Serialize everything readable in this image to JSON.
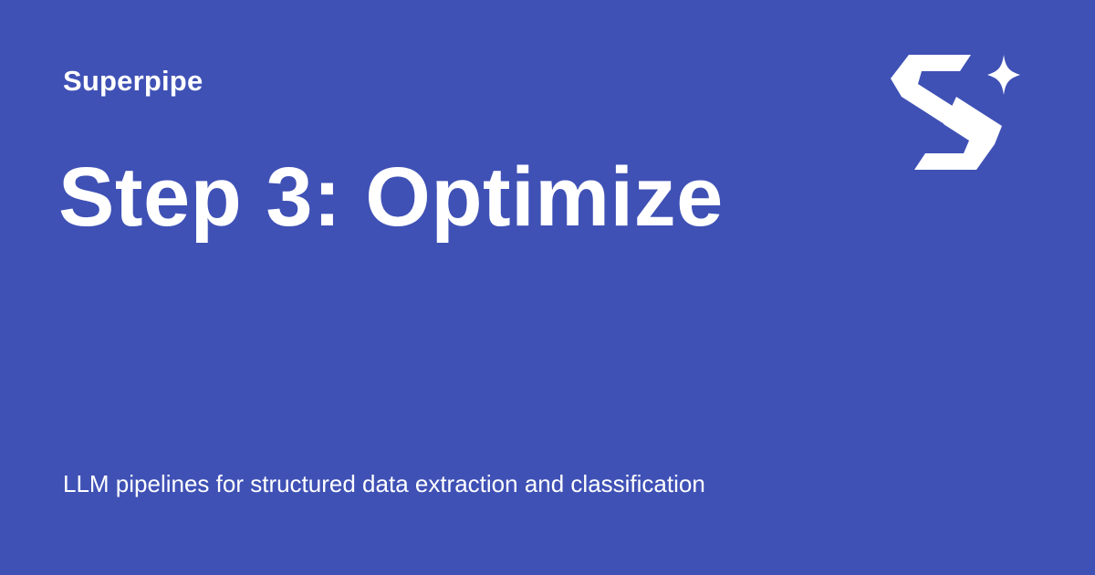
{
  "brand": {
    "name": "Superpipe"
  },
  "hero": {
    "title": "Step 3: Optimize",
    "subtitle": "LLM pipelines for structured data extraction and classification"
  },
  "logo": {
    "icon": "superpipe-s-sparkle-logo-icon"
  },
  "colors": {
    "background": "#3f51b5",
    "foreground": "#ffffff"
  }
}
